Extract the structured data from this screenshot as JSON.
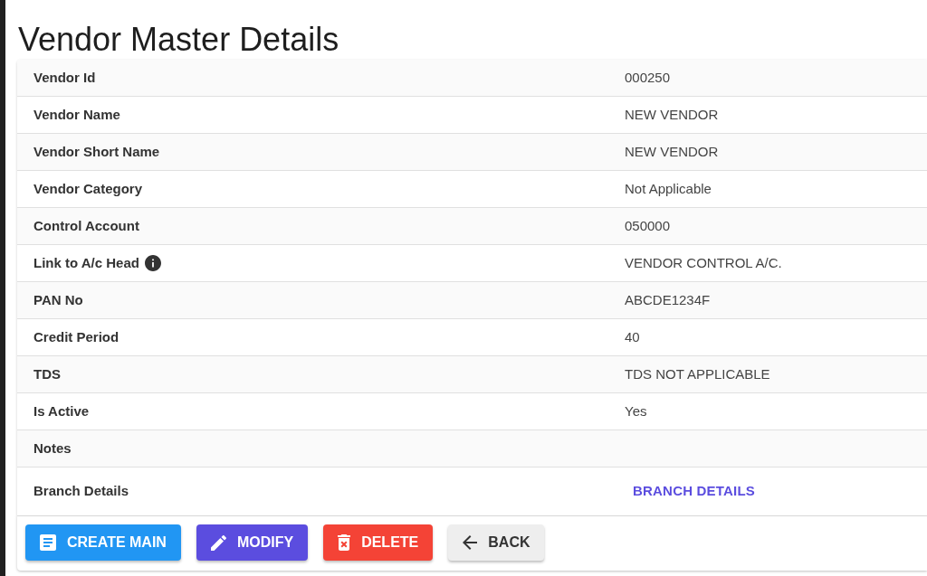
{
  "title": "Vendor Master Details",
  "details": [
    {
      "label": "Vendor Id",
      "kind": "text",
      "value": "000250"
    },
    {
      "label": "Vendor Name",
      "kind": "text",
      "value": "NEW VENDOR"
    },
    {
      "label": "Vendor Short Name",
      "kind": "text",
      "value": "NEW VENDOR"
    },
    {
      "label": "Vendor Category",
      "kind": "text",
      "value": "Not Applicable"
    },
    {
      "label": "Control Account",
      "kind": "text",
      "value": "050000"
    },
    {
      "label": "Link to A/c Head",
      "kind": "text",
      "info": true,
      "value": "VENDOR CONTROL A/C."
    },
    {
      "label": "PAN No",
      "kind": "text",
      "value": "ABCDE1234F"
    },
    {
      "label": "Credit Period",
      "kind": "text",
      "value": "40"
    },
    {
      "label": "TDS",
      "kind": "text",
      "value": "TDS NOT APPLICABLE"
    },
    {
      "label": "Is Active",
      "kind": "text",
      "value": "Yes"
    },
    {
      "label": "Notes",
      "kind": "text"
    },
    {
      "label": "Branch Details",
      "kind": "link",
      "value": "BRANCH DETAILS"
    }
  ],
  "buttons": [
    {
      "label": "CREATE MAIN",
      "kind": "create",
      "color": "#2196f3"
    },
    {
      "label": "MODIFY",
      "kind": "modify",
      "color": "#5b4ddf"
    },
    {
      "label": "DELETE",
      "kind": "delete",
      "color": "#f44336"
    },
    {
      "label": "BACK",
      "kind": "back",
      "color": "#eeeeee"
    }
  ]
}
